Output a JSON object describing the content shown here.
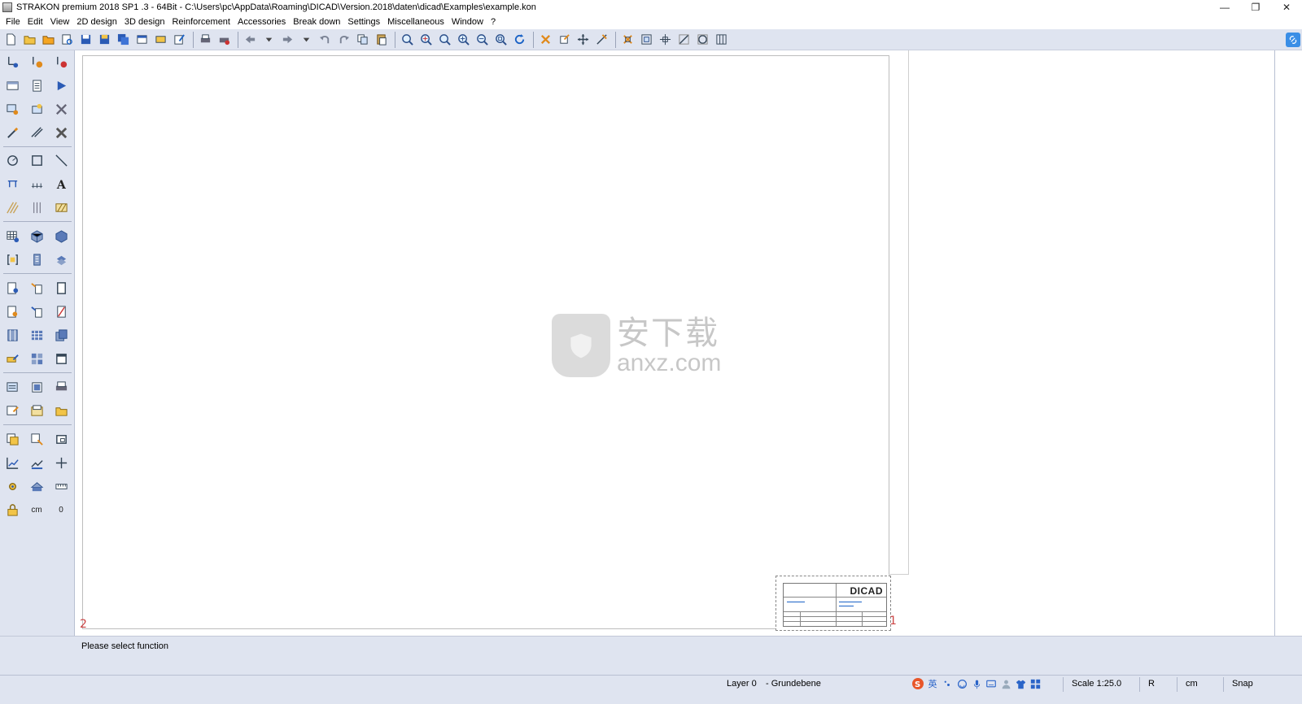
{
  "window": {
    "title": "STRAKON premium 2018 SP1 .3 - 64Bit  - C:\\Users\\pc\\AppData\\Roaming\\DICAD\\Version.2018\\daten\\dicad\\Examples\\example.kon",
    "minimize_glyph": "—",
    "restore_glyph": "❐",
    "close_glyph": "✕"
  },
  "menu": {
    "items": [
      "File",
      "Edit",
      "View",
      "2D design",
      "3D design",
      "Reinforcement",
      "Accessories",
      "Break down",
      "Settings",
      "Miscellaneous",
      "Window",
      "?"
    ]
  },
  "toolbar": {
    "icons": [
      "new-icon",
      "open-icon",
      "open-folder-icon",
      "preview-icon",
      "save-icon",
      "save-as-icon",
      "save-all-icon",
      "window-icon",
      "frame-icon",
      "edit-icon",
      "print-icon",
      "print-setup-icon",
      "back-arrow-icon",
      "forward-arrow-icon",
      "undo-icon",
      "redo-icon",
      "copy-icon",
      "paste-icon",
      "zoom-window-icon",
      "zoom-realtime-icon",
      "zoom-previous-icon",
      "zoom-in-icon",
      "zoom-out-icon",
      "zoom-all-icon",
      "refresh-icon",
      "delete-icon",
      "modify-icon",
      "move-icon",
      "measure-icon",
      "snap-cross-icon",
      "snap-box-icon",
      "snap-center-icon",
      "snap-line-icon",
      "snap-circle-icon",
      "snap-grid-icon"
    ]
  },
  "sidebar": {
    "unit_label": "cm",
    "zero_label": "0"
  },
  "canvas": {
    "title_block_logo": "DICAD",
    "corner_left_label": "2",
    "corner_right_label": "1"
  },
  "watermark": {
    "cn_text": "安下载",
    "en_text": "anxz.com"
  },
  "prompt": {
    "message": "Please select function"
  },
  "status": {
    "layer": "Layer 0",
    "layer_name": "- Grundebene",
    "scale": "Scale 1:25.0",
    "mode": "R",
    "unit": "cm",
    "snap": "Snap",
    "ime_label": "英"
  }
}
